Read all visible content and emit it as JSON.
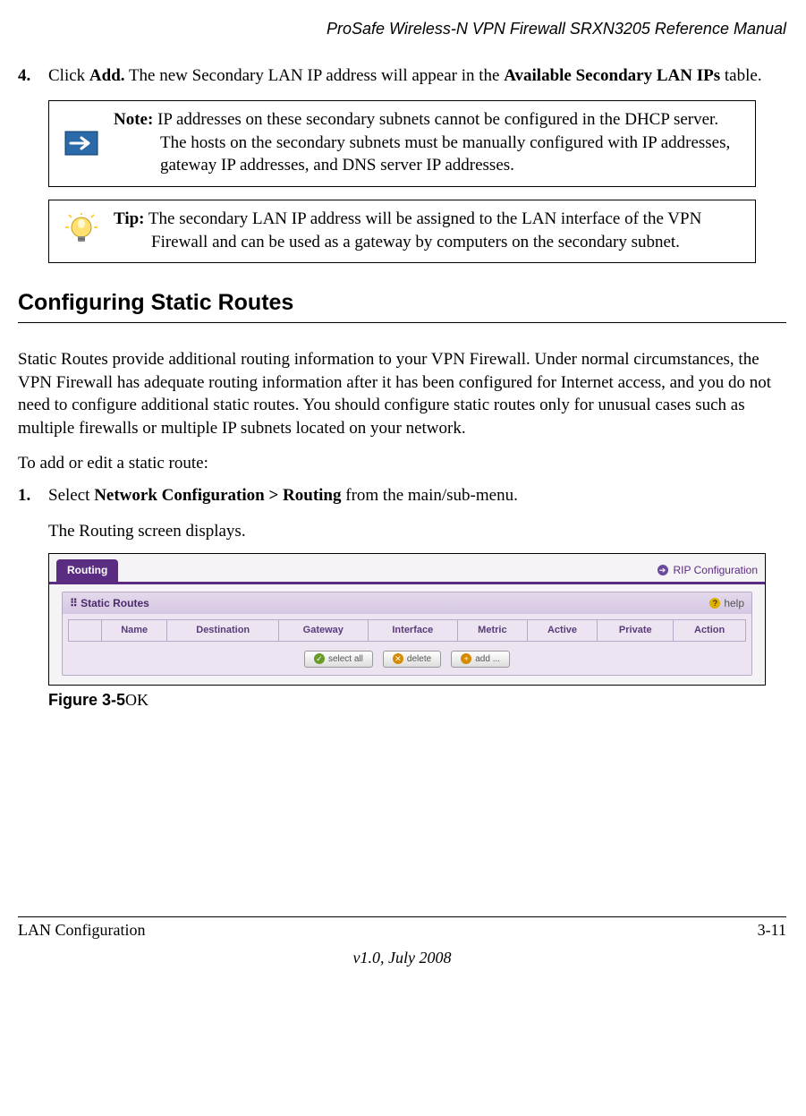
{
  "header": {
    "doc_title": "ProSafe Wireless-N VPN Firewall SRXN3205 Reference Manual"
  },
  "step4": {
    "num": "4.",
    "pre": "Click ",
    "bold1": "Add.",
    "mid": " The new Secondary LAN IP address will appear in the ",
    "bold2": "Available Secondary LAN IPs",
    "post": " table."
  },
  "note": {
    "label": "Note:",
    "text": " IP addresses on these secondary subnets cannot be configured in the DHCP server. The hosts on the secondary subnets must be manually configured with IP addresses, gateway IP addresses, and DNS server IP addresses."
  },
  "tip": {
    "label": "Tip:",
    "text": " The secondary LAN IP address will be assigned to the LAN interface of the VPN Firewall and can be used as a gateway by computers on the secondary subnet."
  },
  "section_heading": "Configuring Static Routes",
  "para1": "Static Routes provide additional routing information to your VPN Firewall. Under normal circumstances, the VPN Firewall has adequate routing information after it has been configured for Internet access, and you do not need to configure additional static routes. You should configure static routes only for unusual cases such as multiple firewalls or multiple IP subnets located on your network.",
  "para2": "To add or edit a static route:",
  "step1": {
    "num": "1.",
    "pre": "Select ",
    "bold": "Network Configuration > Routing",
    "post": " from the main/sub-menu.",
    "after": "The Routing screen displays."
  },
  "ui": {
    "tab": "Routing",
    "link": "RIP Configuration",
    "panel_title": "Static Routes",
    "help": "help",
    "columns": [
      "Name",
      "Destination",
      "Gateway",
      "Interface",
      "Metric",
      "Active",
      "Private",
      "Action"
    ],
    "btn_select_all": "select all",
    "btn_delete": "delete",
    "btn_add": "add ..."
  },
  "figure": {
    "label": "Figure 3-5",
    "suffix": "OK"
  },
  "footer": {
    "left": "LAN Configuration",
    "right": "3-11",
    "center": "v1.0, July 2008"
  },
  "chart_data": {
    "type": "table",
    "title": "Static Routes",
    "columns": [
      "Name",
      "Destination",
      "Gateway",
      "Interface",
      "Metric",
      "Active",
      "Private",
      "Action"
    ],
    "rows": []
  }
}
